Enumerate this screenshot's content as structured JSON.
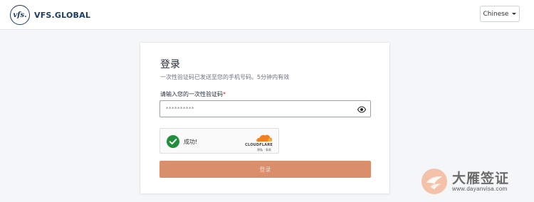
{
  "header": {
    "brand": "VFS.GLOBAL",
    "logo_mark": "vfs.",
    "language": "Chinese"
  },
  "card": {
    "title": "登录",
    "subtitle": "一次性验证码已发送至您的手机号码。5分钟内有效",
    "otp_label": "请输入您的一次性验证码",
    "required_mark": "*",
    "otp_value": "**********",
    "captcha_status": "成功!",
    "captcha_brand": "CLOUDFLARE",
    "captcha_links": "隐私 · 条款",
    "login_label": "登录"
  },
  "watermark": {
    "title": "大雁签证",
    "url": "www.dayanvisa.com"
  },
  "colors": {
    "brand": "#1b3a68",
    "button": "#d98f6c",
    "success": "#1f8f3a",
    "cloudflare": "#f38020"
  },
  "icons": [
    "caret-down-icon",
    "eye-icon",
    "check-circle-icon",
    "cloudflare-logo-icon",
    "dayan-emblem-icon"
  ]
}
